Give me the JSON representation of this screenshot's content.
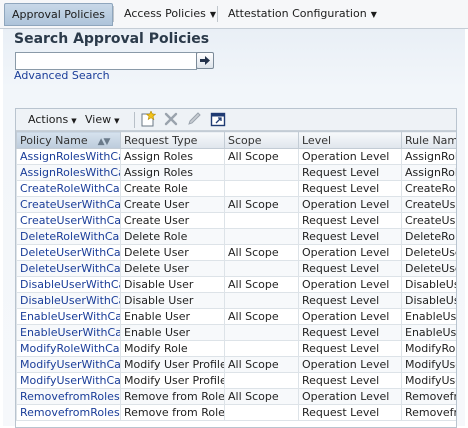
{
  "tabs": [
    {
      "label": "Approval Policies",
      "active": true,
      "has_menu": false
    },
    {
      "label": "Access Policies",
      "active": false,
      "has_menu": true
    },
    {
      "label": "Attestation Configuration",
      "active": false,
      "has_menu": true
    }
  ],
  "search": {
    "title": "Search Approval Policies",
    "input_value": "",
    "advanced_label": "Advanced Search"
  },
  "toolbar": {
    "actions_label": "Actions",
    "view_label": "View"
  },
  "icons": {
    "go": "arrow-right-icon",
    "create": "create-icon",
    "delete": "delete-x-icon",
    "edit": "pencil-icon",
    "detach": "detach-icon"
  },
  "table": {
    "columns": [
      "Policy Name",
      "Request Type",
      "Scope",
      "Level",
      "Rule Name"
    ],
    "rows": [
      [
        "AssignRolesWithCallback",
        "Assign Roles",
        "All Scope",
        "Operation Level",
        "AssignRoles"
      ],
      [
        "AssignRolesWithCallback",
        "Assign Roles",
        "",
        "Request Level",
        "AssignRoles"
      ],
      [
        "CreateRoleWithCallback",
        "Create Role",
        "",
        "Request Level",
        "CreateRole"
      ],
      [
        "CreateUserWithCallback",
        "Create User",
        "All Scope",
        "Operation Level",
        "CreateUser"
      ],
      [
        "CreateUserWithCallback",
        "Create User",
        "",
        "Request Level",
        "CreateUser"
      ],
      [
        "DeleteRoleWithCallback",
        "Delete Role",
        "",
        "Request Level",
        "DeleteRole"
      ],
      [
        "DeleteUserWithCallback",
        "Delete User",
        "All Scope",
        "Operation Level",
        "DeleteUser"
      ],
      [
        "DeleteUserWithCallback",
        "Delete User",
        "",
        "Request Level",
        "DeleteUser"
      ],
      [
        "DisableUserWithCallback",
        "Disable User",
        "All Scope",
        "Operation Level",
        "DisableUser"
      ],
      [
        "DisableUserWithCallback",
        "Disable User",
        "",
        "Request Level",
        "DisableUser"
      ],
      [
        "EnableUserWithCallback",
        "Enable User",
        "All Scope",
        "Operation Level",
        "EnableUser"
      ],
      [
        "EnableUserWithCallback",
        "Enable User",
        "",
        "Request Level",
        "EnableUser"
      ],
      [
        "ModifyRoleWithCallback",
        "Modify Role",
        "",
        "Request Level",
        "ModifyRole"
      ],
      [
        "ModifyUserWithCallback",
        "Modify User Profile",
        "All Scope",
        "Operation Level",
        "ModifyUser"
      ],
      [
        "ModifyUserWithCallback",
        "Modify User Profile",
        "",
        "Request Level",
        "ModifyUser"
      ],
      [
        "RemovefromRolesWithCallback",
        "Remove from Roles",
        "All Scope",
        "Operation Level",
        "Removefrom"
      ],
      [
        "RemovefromRolesWithCallback",
        "Remove from Roles",
        "",
        "Request Level",
        "Removefrom"
      ]
    ]
  }
}
